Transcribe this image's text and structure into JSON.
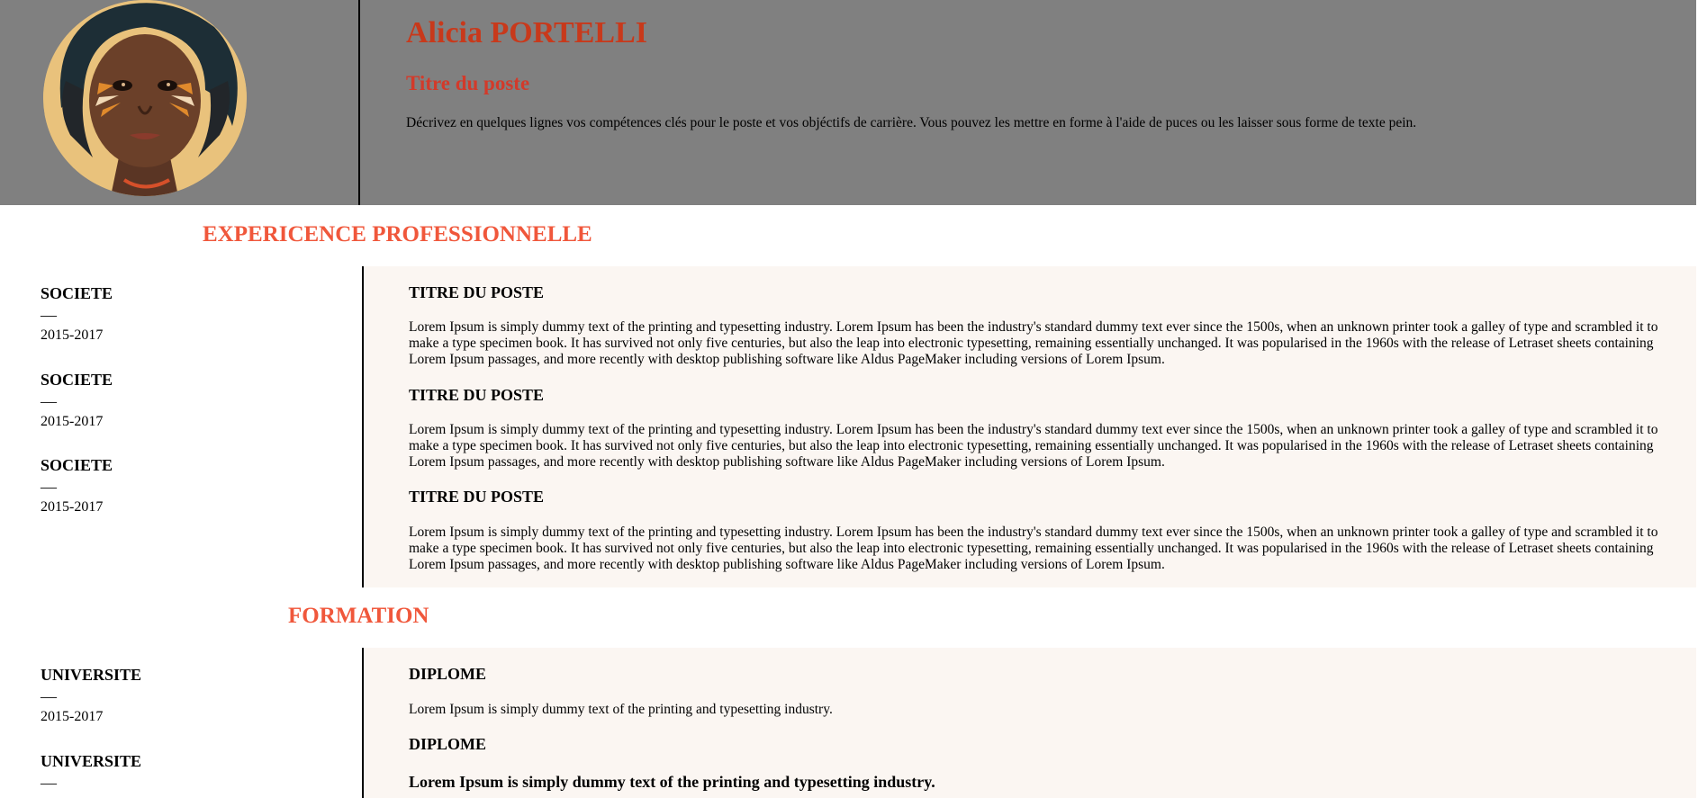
{
  "header": {
    "name": "Alicia PORTELLI",
    "job_title": "Titre du poste",
    "summary": "Décrivez en quelques lignes vos compétences clés pour le poste et vos objéctifs de carrière. Vous pouvez les mettre en forme à l'aide de puces ou les laisser sous forme de texte pein."
  },
  "experience": {
    "title": "EXPERICENCE PROFESSIONNELLE",
    "left": [
      {
        "org": "SOCIETE",
        "dash": "—",
        "dates": "2015-2017"
      },
      {
        "org": "SOCIETE",
        "dash": "—",
        "dates": "2015-2017"
      },
      {
        "org": "SOCIETE",
        "dash": "—",
        "dates": "2015-2017"
      }
    ],
    "right": [
      {
        "title": "TITRE DU POSTE",
        "desc": "Lorem Ipsum is simply dummy text of the printing and typesetting industry. Lorem Ipsum has been the industry's standard dummy text ever since the 1500s, when an unknown printer took a galley of type and scrambled it to make a type specimen book. It has survived not only five centuries, but also the leap into electronic typesetting, remaining essentially unchanged. It was popularised in the 1960s with the release of Letraset sheets containing Lorem Ipsum passages, and more recently with desktop publishing software like Aldus PageMaker including versions of Lorem Ipsum."
      },
      {
        "title": "TITRE DU POSTE",
        "desc": "Lorem Ipsum is simply dummy text of the printing and typesetting industry. Lorem Ipsum has been the industry's standard dummy text ever since the 1500s, when an unknown printer took a galley of type and scrambled it to make a type specimen book. It has survived not only five centuries, but also the leap into electronic typesetting, remaining essentially unchanged. It was popularised in the 1960s with the release of Letraset sheets containing Lorem Ipsum passages, and more recently with desktop publishing software like Aldus PageMaker including versions of Lorem Ipsum."
      },
      {
        "title": "TITRE DU POSTE",
        "desc": "Lorem Ipsum is simply dummy text of the printing and typesetting industry. Lorem Ipsum has been the industry's standard dummy text ever since the 1500s, when an unknown printer took a galley of type and scrambled it to make a type specimen book. It has survived not only five centuries, but also the leap into electronic typesetting, remaining essentially unchanged. It was popularised in the 1960s with the release of Letraset sheets containing Lorem Ipsum passages, and more recently with desktop publishing software like Aldus PageMaker including versions of Lorem Ipsum."
      }
    ]
  },
  "formation": {
    "title": "FORMATION",
    "left": [
      {
        "org": "UNIVERSITE",
        "dash": "—",
        "dates": "2015-2017"
      },
      {
        "org": "UNIVERSITE",
        "dash": "—"
      }
    ],
    "right": [
      {
        "title": "DIPLOME",
        "desc": "Lorem Ipsum is simply dummy text of the printing and typesetting industry."
      },
      {
        "title": "DIPLOME",
        "desc": "Lorem Ipsum is simply dummy text of the printing and typesetting industry."
      }
    ]
  },
  "colors": {
    "header_bg": "#808080",
    "accent": "#f0573b",
    "name": "#c8391b",
    "panel_bg": "#fbf6f2"
  },
  "icons": {
    "avatar": "portrait-illustration"
  }
}
